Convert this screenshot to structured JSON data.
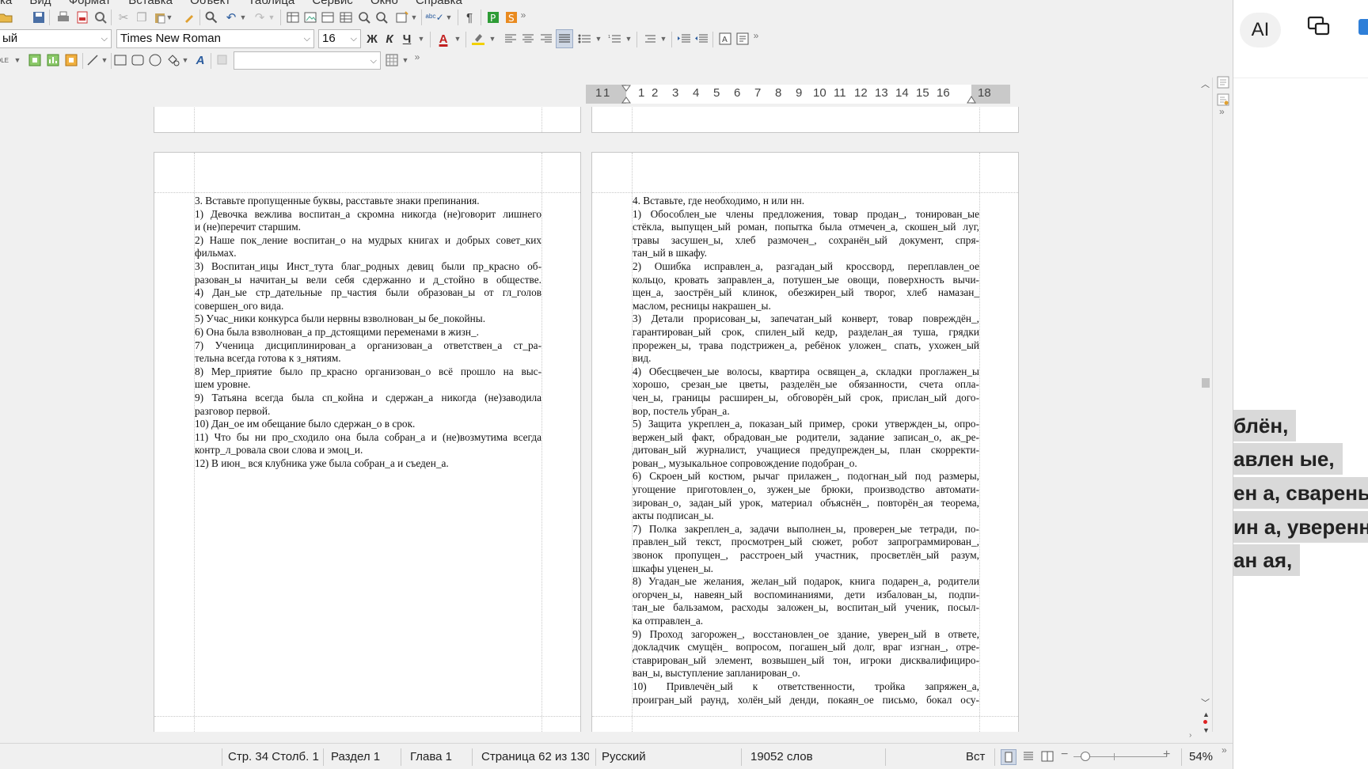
{
  "menubar": [
    "ка",
    "Вид",
    "Формат",
    "Вставка",
    "Объект",
    "Таблица",
    "Сервис",
    "Окно",
    "Справка"
  ],
  "toolbar2": {
    "style_value": "ый",
    "font_value": "Times New Roman",
    "size_value": "16",
    "bold": "Ж",
    "italic": "К",
    "underline": "Ч",
    "font_color": "A"
  },
  "ruler": {
    "labels": [
      "1",
      "1",
      "1",
      "2",
      "3",
      "4",
      "5",
      "6",
      "7",
      "8",
      "9",
      "10",
      "11",
      "12",
      "13",
      "14",
      "15",
      "16",
      "18"
    ]
  },
  "page_left": {
    "lines": [
      "3. Вставьте пропущенные буквы, расставьте знаки препинания.",
      "1) Девочка вежлива воспитан_а скромна никогда (не)говорит лишнего",
      "и (не)перечит старшим.",
      "2) Наше пок_ление воспитан_о на мудрых книгах и добрых совет_ких",
      "фильмах.",
      "3) Воспитан_ицы Инст_тута благ_родных девиц были пр_красно об-",
      "разован_ы начитан_ы вели себя сдержанно и д_стойно в обществе.",
      "4) Дан_ые стр_дательные пр_частия были образован_ы от гл_голов",
      "совершен_ого вида.",
      "5) Учас_ники конкурса были нервны взволнован_ы бе_покойны.",
      "6) Она была взволнован_а пр_дстоящими переменами в жизн_.",
      "7) Ученица дисциплинирован_а организован_а ответствен_а ст_ра-",
      "тельна всегда готова к з_нятиям.",
      "8) Мер_приятие было пр_красно организован_о всё прошло на выс-",
      "шем уровне.",
      "9) Татьяна всегда была сп_койна и сдержан_а никогда (не)заводила",
      "разговор первой.",
      "10) Дан_ое им обещание было сдержан_о в срок.",
      "11) Что бы ни про_сходило она была собран_а и (не)возмутима всегда",
      "контр_л_ровала свои слова и эмоц_и.",
      "12) В июн_ вся клубника уже была собран_а и съеден_а."
    ]
  },
  "page_right": {
    "lines": [
      "4. Вставьте, где необходимо, н или нн.",
      "1) Обособлен_ые члены предложения, товар продан_, тонирован_ые",
      "стёкла, выпущен_ый роман, попытка была отмечен_а, скошен_ый луг,",
      "травы засушен_ы, хлеб размочен_, сохранён_ый документ, спря-",
      "тан_ый в шкафу.",
      "2) Ошибка исправлен_а, разгадан_ый кроссворд, переплавлен_ое",
      "кольцо, кровать заправлен_а, потушен_ые овощи, поверхность вычи-",
      "щен_а, заострён_ый клинок, обезжирен_ый творог, хлеб намазан_",
      "маслом, ресницы накрашен_ы.",
      "3) Детали прорисован_ы, запечатан_ый конверт, товар повреждён_,",
      "гарантирован_ый срок, спилен_ый кедр, разделан_ая туша, грядки",
      "прорежен_ы, трава подстрижен_а, ребёнок уложен_ спать, ухожен_ый",
      "вид.",
      "4) Обесцвечен_ые волосы, квартира освящен_а, складки проглажен_ы",
      "хорошо, срезан_ые цветы, разделён_ые обязанности, счета опла-",
      "чен_ы, границы расширен_ы, обговорён_ый срок, прислан_ый дого-",
      "вор, постель убран_а.",
      "5) Защита укреплен_а, показан_ый пример, сроки утвержден_ы, опро-",
      "вержен_ый факт, обрадован_ые родители, задание записан_о, ак_ре-",
      "дитован_ый журналист, учащиеся предупрежден_ы, план скорректи-",
      "рован_, музыкальное сопровождение подобран_о.",
      "6) Скроен_ый костюм, рычаг прилажен_, подогнан_ый под размеры,",
      "угощение приготовлен_о, зужен_ые брюки, производство автомати-",
      "зирован_о, задан_ый урок, материал объяснён_, повторён_ая теорема,",
      "акты подписан_ы.",
      "7) Полка закреплен_а, задачи выполнен_ы, проверен_ые тетради, по-",
      "правлен_ый текст, просмотрен_ый сюжет, робот запрограммирован_,",
      "звонок пропущен_, расстроен_ый участник, просветлён_ый разум,",
      "шкафы уценен_ы.",
      "8) Угадан_ые желания, желан_ый подарок, книга подарен_а, родители",
      "огорчен_ы, навеян_ый воспоминаниями, дети избалован_ы, подпи-",
      "тан_ые бальзамом, расходы заложен_ы, воспитан_ый ученик, посыл-",
      "ка отправлен_а.",
      "9) Проход загорожен_, восстановлен_ое здание, уверен_ый в ответе,",
      "докладчик смущён_ вопросом, погашен_ый долг, враг изгнан_, отре-",
      "ставрирован_ый элемент, возвышен_ый тон, игроки дисквалифициро-",
      "ван_ы, выступление запланирован_о.",
      "10)   Привлечён_ый   к   ответственности,   тройка   запряжен_а,",
      "проигран_ый раунд, холён_ый денди, покаян_ое письмо, бокал осу-"
    ]
  },
  "status": {
    "page_col": "Стр. 34 Столб. 1",
    "section": "Раздел 1",
    "chapter": "Глава 1",
    "page_count": "Страница 62 из 130",
    "language": "Русский",
    "words": "19052 слов",
    "mode": "Вст",
    "zoom": "54%"
  },
  "right_panel": {
    "ai_label": "AI",
    "lines": [
      "блён,",
      "авлен ые,",
      "ен а, свареный",
      "ин а, уверенный",
      "ан ая,"
    ]
  }
}
